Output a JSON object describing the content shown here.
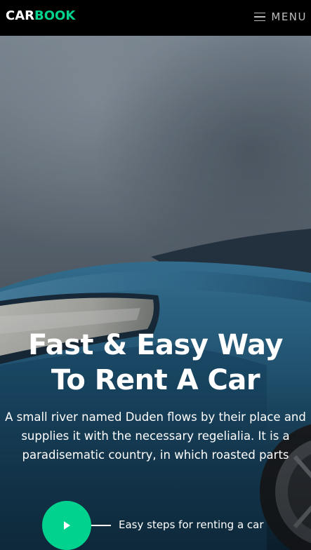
{
  "navbar": {
    "brand_part1": "CAR",
    "brand_part2": "BOOK",
    "menu_label": "MENU",
    "menu_icon": "hamburger-icon"
  },
  "hero": {
    "title_line1": "Fast & Easy Way",
    "title_line2": "To Rent A Car",
    "description": "A small river named Duden flows by their place and supplies it with the necessary regelialia. It is a paradisematic country, in which roasted parts",
    "play_icon": "play-icon",
    "play_caption": "Easy steps for renting a car",
    "background_image": "blue car headlight under cloudy sky"
  },
  "colors": {
    "accent": "#01d28e",
    "navbar_bg": "#000000",
    "text": "#ffffff",
    "menu_text": "#bdbdbd"
  }
}
